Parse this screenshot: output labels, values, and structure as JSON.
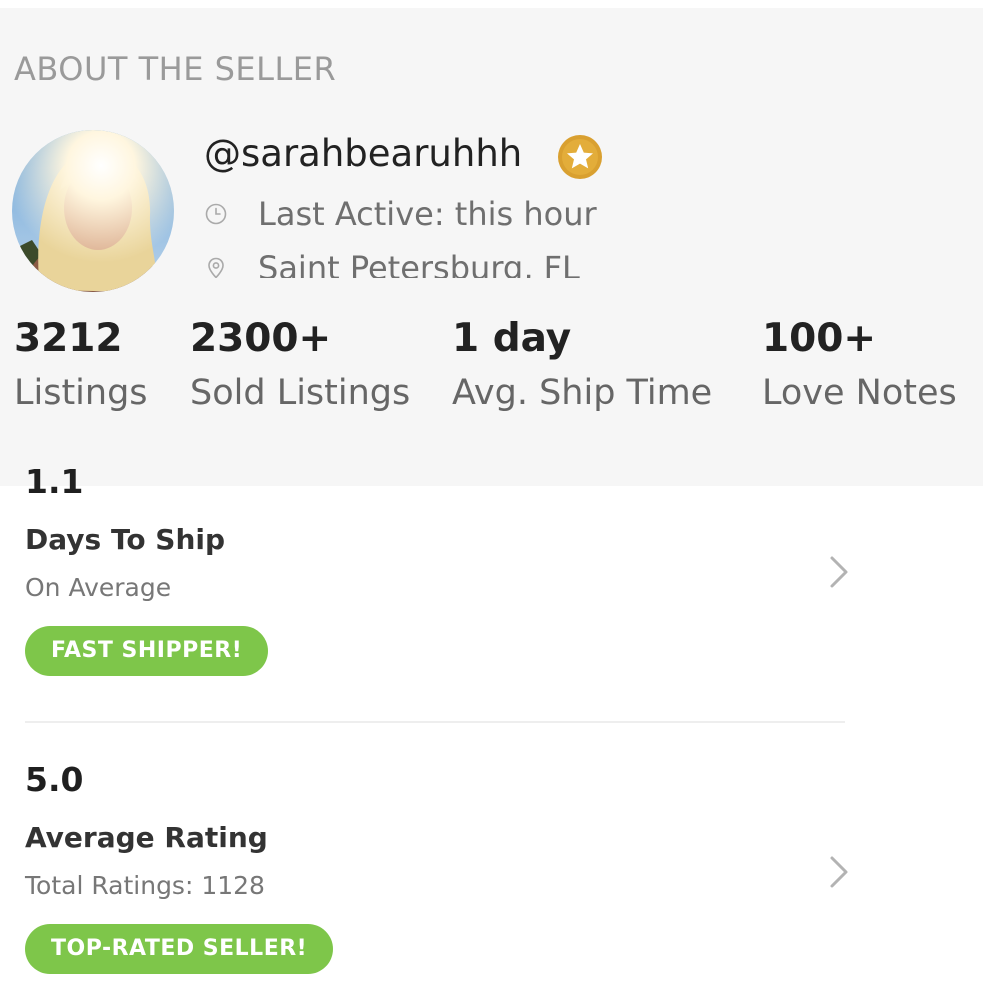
{
  "section": {
    "heading": "ABOUT THE SELLER"
  },
  "seller": {
    "avatar_icon": "avatar-photo",
    "username": "@sarahbearuhhh",
    "badge_icon": "gold-star-badge",
    "badge_color": "#d9a030",
    "last_active": "Last Active: this hour",
    "last_active_icon": "clock-icon",
    "location": "Saint Petersburg, FL",
    "location_icon": "location-pin-icon"
  },
  "stats": [
    {
      "value": "3212",
      "label": "Listings"
    },
    {
      "value": "2300+",
      "label": "Sold Listings"
    },
    {
      "value": "1 day",
      "label": "Avg. Ship Time"
    },
    {
      "value": "100+",
      "label": "Love Notes"
    }
  ],
  "metrics": [
    {
      "value": "1.1",
      "title": "Days To Ship",
      "subtitle": "On Average",
      "badge": "FAST SHIPPER!",
      "chevron_icon": "chevron-right-icon"
    },
    {
      "value": "5.0",
      "title": "Average Rating",
      "subtitle": "Total Ratings: 1128",
      "badge": "TOP-RATED SELLER!",
      "chevron_icon": "chevron-right-icon"
    }
  ],
  "colors": {
    "badge_green": "#7ec64a",
    "panel_background": "#f6f6f6"
  }
}
